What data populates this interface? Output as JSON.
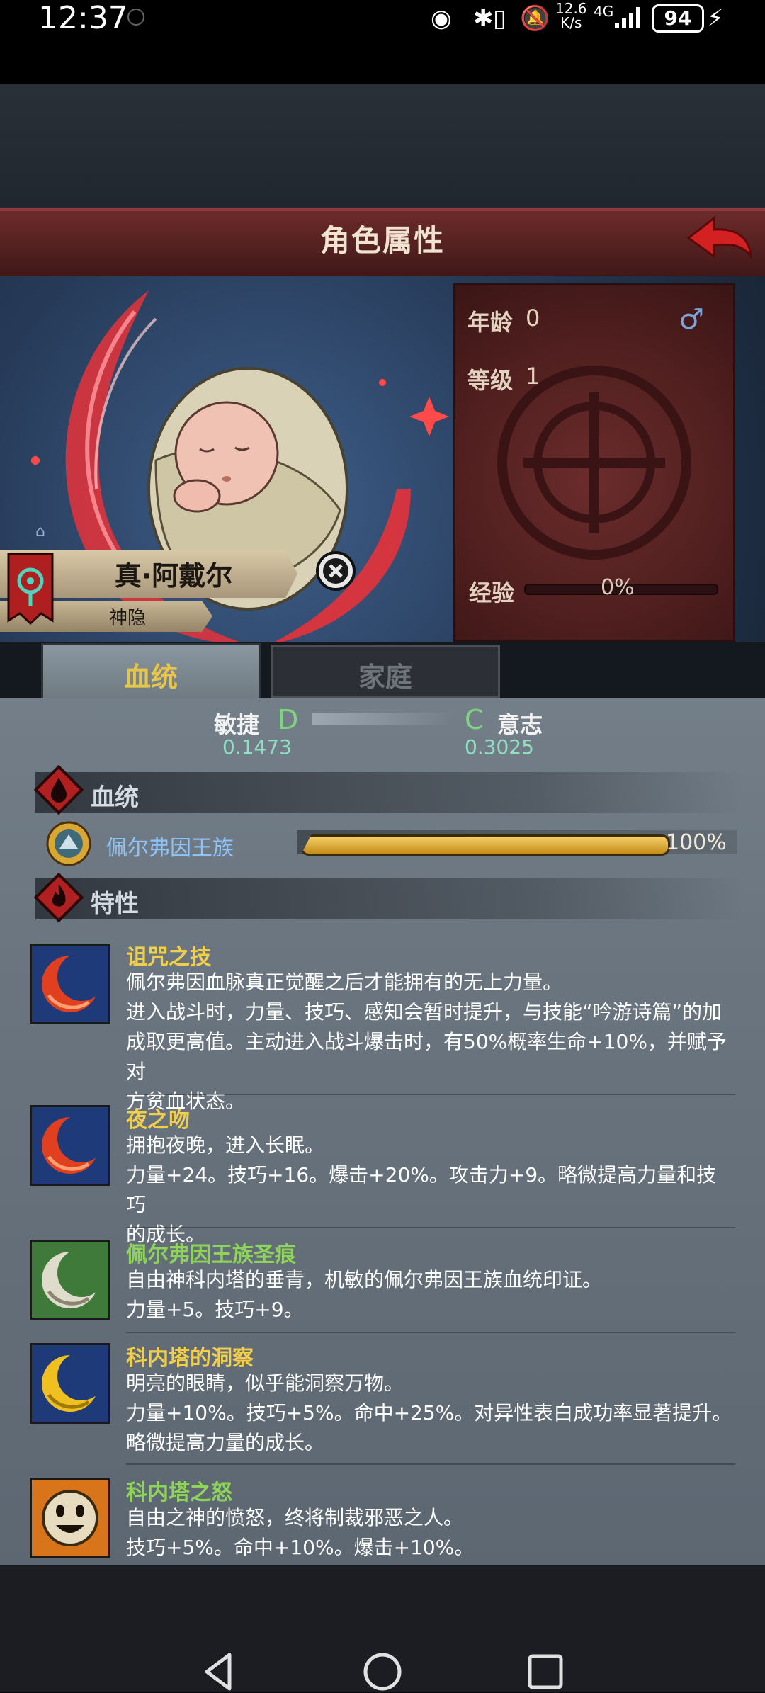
{
  "status_bar": {
    "time": "12:37",
    "net_speed_top": "12.6",
    "net_speed_bottom": "K/s",
    "network": "4G",
    "battery": "94"
  },
  "header": {
    "title": "角色属性"
  },
  "character": {
    "age_label": "年龄",
    "age_value": "0",
    "level_label": "等级",
    "level_value": "1",
    "exp_label": "经验",
    "exp_value": "0%",
    "exp_fraction": 0,
    "name": "真·阿戴尔",
    "subtitle": "神隐",
    "gender_icon": "male-symbol-icon"
  },
  "tabs": [
    {
      "label": "血统",
      "active": true
    },
    {
      "label": "家庭",
      "active": false
    }
  ],
  "stats": [
    {
      "name": "敏捷",
      "grade": "D",
      "value": "0.1473"
    },
    {
      "name": "意志",
      "grade": "C",
      "value": "0.3025"
    }
  ],
  "bloodline_section": {
    "title": "血统",
    "name": "佩尔弗因王族",
    "percent": "100%",
    "fraction": 1.0
  },
  "traits_section": {
    "title": "特性",
    "traits": [
      {
        "name": "诅咒之技",
        "lines": [
          "佩尔弗因血脉真正觉醒之后才能拥有的无上力量。",
          "进入战斗时，力量、技巧、感知会暂时提升，与技能“吟游诗篇”的加",
          "成取更高值。主动进入战斗爆击时，有50%概率生命+10%，并赋予对",
          "方贫血状态。"
        ]
      },
      {
        "name": "夜之吻",
        "lines": [
          "拥抱夜晚，进入长眠。",
          "力量+24。技巧+16。爆击+20%。攻击力+9。略微提高力量和技巧",
          "的成长。"
        ]
      },
      {
        "name": "佩尔弗因王族圣痕",
        "lines": [
          "自由神科内塔的垂青，机敏的佩尔弗因王族血统印证。",
          "力量+5。技巧+9。"
        ]
      },
      {
        "name": "科内塔的洞察",
        "lines": [
          "明亮的眼睛，似乎能洞察万物。",
          "力量+10%。技巧+5%。命中+25%。对异性表白成功率显著提升。",
          "略微提高力量的成长。"
        ]
      },
      {
        "name": "科内塔之怒",
        "lines": [
          "自由之神的愤怒，终将制裁邪恶之人。",
          "技巧+5%。命中+10%。爆击+10%。"
        ]
      }
    ]
  },
  "colors": {
    "trait_name": "#f2cf4a",
    "trait_name_green": "#8fd45a",
    "bloodline_name": "#8fc3f5",
    "grade": "#7fd47f",
    "stat_value": "#8ee0c0"
  }
}
